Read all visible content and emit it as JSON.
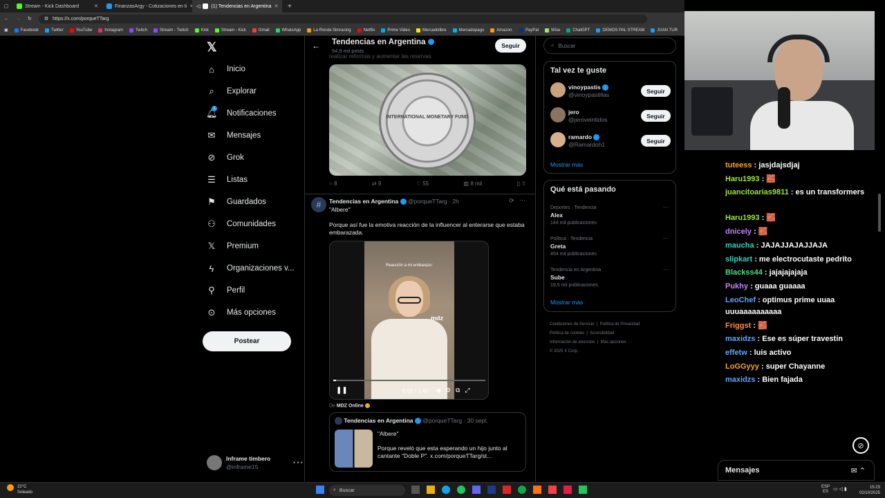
{
  "browser": {
    "tabs": [
      {
        "title": "Stream - Kick Dashboard",
        "color": "#53fc18"
      },
      {
        "title": "FinanzasArgy - Cotizaciones en ti",
        "color": "#1d9bf0"
      },
      {
        "title": "(1) Tendencias en Argentina",
        "color": "#ffffff"
      }
    ],
    "url": "https://x.com/porqueTTarg",
    "bookmarks": [
      "Facebook",
      "Twitter",
      "YouTube",
      "Instagram",
      "Twitch",
      "Stream - Twitch",
      "Kick",
      "Stream - Kick",
      "Gmail",
      "WhatsApp",
      "La Ronda Simracing",
      "Netflix",
      "Prime Video",
      "Mercadolibre",
      "Mercadopago",
      "Amazon.",
      "PayPal",
      "Wise",
      "ChatGPT",
      "DEMOS PAL STREAM",
      "JUAN TUR"
    ]
  },
  "nav": {
    "items": [
      "Inicio",
      "Explorar",
      "Notificaciones",
      "Mensajes",
      "Grok",
      "Listas",
      "Guardados",
      "Comunidades",
      "Premium",
      "Organizaciones v...",
      "Perfil",
      "Más opciones"
    ],
    "notif_badge": "1",
    "post_button": "Postear",
    "account_name": "Inframe timbero",
    "account_handle": "@inframe15"
  },
  "header": {
    "title": "Tendencias en Argentina",
    "subtitle": "54,9 mil posts",
    "follow": "Seguir",
    "cut_text": "realizar reformas y aumentar las reservas."
  },
  "post1_image": {
    "caption": "INTERNATIONAL MONETARY FUND"
  },
  "post1_stats": {
    "replies": "8",
    "reposts": "9",
    "likes": "55",
    "views": "8 mil"
  },
  "post2": {
    "name": "Tendencias en Argentina",
    "handle": "@porqueTTarg",
    "time": "2h",
    "quote": "\"Albere\"",
    "text": "Porque así fue la emotiva reacción de la influencer al enterarse que estaba embarazada.",
    "video_overlay": "Reacción a mi embarazo:",
    "video_logo": "mdz",
    "video_time": "0:02 / 1:40",
    "video_progress": 0.02,
    "from_label": "De",
    "from_source": "MDZ Online",
    "quoted": {
      "name": "Tendencias en Argentina",
      "handle": "@porqueTTarg",
      "date": "30 sept.",
      "title": "\"Albere\"",
      "text": "Porque reveló que esta esperando un hijo junto al cantante \"Doble P\". x.com/porqueTTarg/st..."
    }
  },
  "sidebar": {
    "search_placeholder": "Buscar",
    "suggest_title": "Tal vez te guste",
    "suggestions": [
      {
        "name": "vinoypastis",
        "handle": "@vinoypastillas",
        "follow": "Seguir"
      },
      {
        "name": "jero",
        "handle": "@jeroveintidos",
        "follow": "Seguir"
      },
      {
        "name": "ramardo",
        "handle": "@Ramardoh1",
        "follow": "Seguir"
      }
    ],
    "show_more": "Mostrar más",
    "trends_title": "Qué está pasando",
    "trends": [
      {
        "context": "Deportes · Tendencia",
        "name": "Alex",
        "count": "144 mil publicaciones"
      },
      {
        "context": "Política · Tendencia",
        "name": "Greta",
        "count": "454 mil publicaciones"
      },
      {
        "context": "Tendencia en Argentina",
        "name": "Sube",
        "count": "19,5 mil publicaciones"
      }
    ],
    "trends_more": "Mostrar más",
    "footer": [
      "Condiciones de Servicio",
      "Política de Privacidad",
      "Política de cookies",
      "Accesibilidad",
      "Información de anuncios",
      "Más opciones ···",
      "© 2025 X Corp."
    ]
  },
  "chat": {
    "messages": [
      {
        "user": "tuteess",
        "text": "jasjdajsdjaj",
        "color": "#f5a623"
      },
      {
        "user": "Haru1993",
        "text": "🧱",
        "color": "#a3e635"
      },
      {
        "user": "juancitoarias9811",
        "text": "es un transformers",
        "color": "#a3e635"
      },
      {
        "user": "Haru1993",
        "text": "🧱",
        "color": "#a3e635"
      },
      {
        "user": "dnicely",
        "text": "🧱",
        "color": "#c084fc"
      },
      {
        "user": "maucha",
        "text": "JAJAJJAJAJJAJA",
        "color": "#2dd4bf"
      },
      {
        "user": "slipkart",
        "text": "me electrocutaste pedrito",
        "color": "#2dd4bf"
      },
      {
        "user": "Blackss44",
        "text": "jajajajajaja",
        "color": "#4ade80"
      },
      {
        "user": "Pukhy",
        "text": "guaaa guaaaa",
        "color": "#c084fc"
      },
      {
        "user": "LeoChef",
        "text": "optimus prime uuaa uuuaaaaaaaaaa",
        "color": "#60a5fa"
      },
      {
        "user": "Friggst",
        "text": "🧱",
        "color": "#fb923c"
      },
      {
        "user": "maxidzs",
        "text": "Ese es súper travestin",
        "color": "#60a5fa"
      },
      {
        "user": "effetw",
        "text": "luis activo",
        "color": "#60a5fa"
      },
      {
        "user": "LoGGyyy",
        "text": "super Chayanne",
        "color": "#f5a623"
      },
      {
        "user": "maxidzs",
        "text": "Bien fajada",
        "color": "#60a5fa"
      }
    ],
    "messages_label": "Mensajes"
  },
  "taskbar": {
    "weather_temp": "22°C",
    "weather_desc": "Soleado",
    "search": "Buscar",
    "lang1": "ESP",
    "lang2": "ES",
    "time": "15:23",
    "date": "02/10/2025"
  }
}
